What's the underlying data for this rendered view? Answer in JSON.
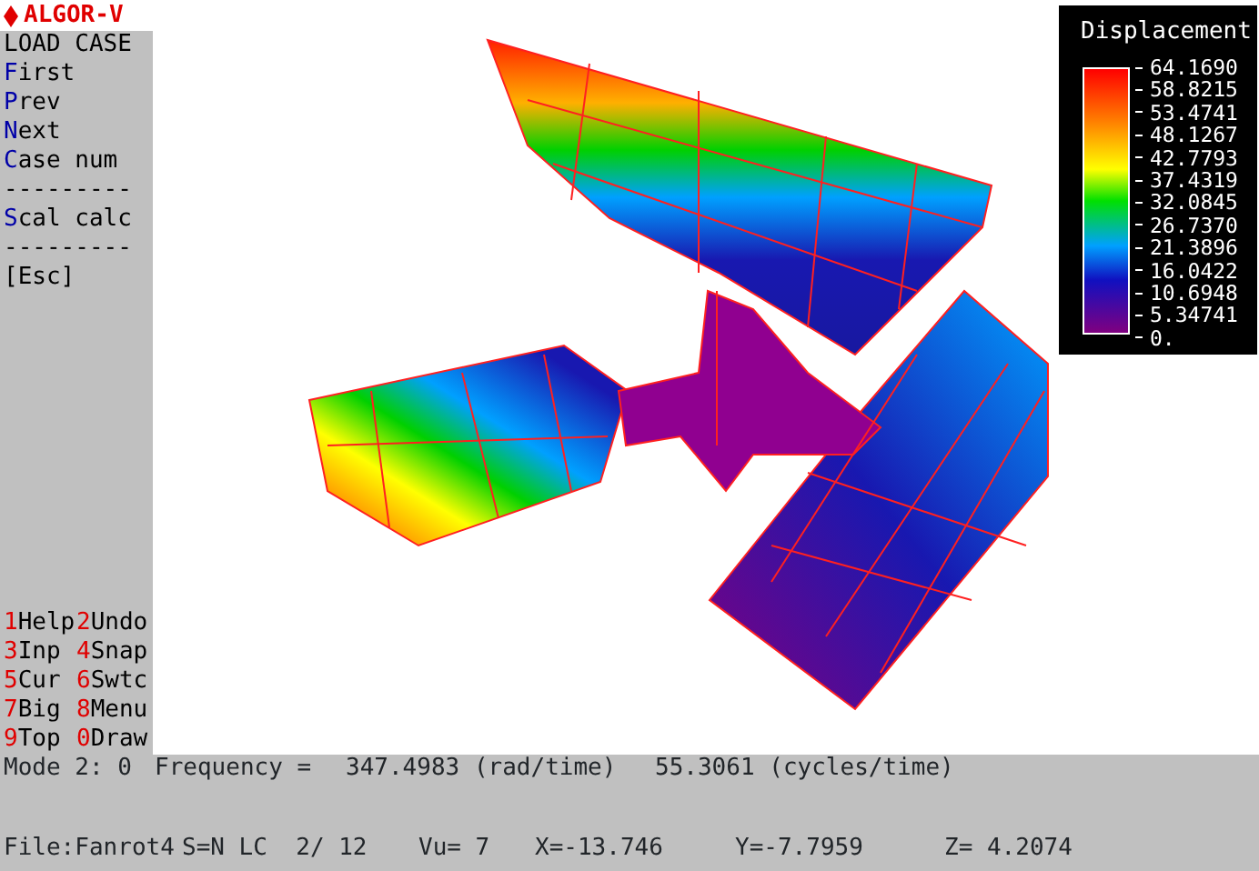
{
  "app_title": "ALGOR-V",
  "menu": {
    "heading": "LOAD CASE",
    "items": [
      {
        "kind": "command",
        "label": "First"
      },
      {
        "kind": "command",
        "label": "Prev"
      },
      {
        "kind": "command",
        "label": "Next"
      },
      {
        "kind": "command",
        "label": "Case num"
      },
      {
        "kind": "separator",
        "label": "---------"
      },
      {
        "kind": "command",
        "label": "Scal calc"
      },
      {
        "kind": "separator",
        "label": "---------"
      },
      {
        "kind": "plain",
        "label": "[Esc]"
      }
    ]
  },
  "function_keys": [
    [
      "1Help",
      "2Undo"
    ],
    [
      "3Inp",
      "4Snap"
    ],
    [
      "5Cur",
      "6Swtc"
    ],
    [
      "7Big",
      "8Menu"
    ],
    [
      "9Top",
      "0Draw"
    ]
  ],
  "legend": {
    "title": "Displacement",
    "labels": [
      "64.1690",
      "58.8215",
      "53.4741",
      "48.1267",
      "42.7793",
      "37.4319",
      "32.0845",
      "26.7370",
      "21.3896",
      "16.0422",
      "10.6948",
      "5.34741",
      "0."
    ]
  },
  "mode_line": [
    "Mode 2: 0",
    "Frequency =",
    "347.4983 (rad/time)",
    "55.3061 (cycles/time)"
  ],
  "status_bar": [
    "File:Fanrot4",
    "S=N LC  2/ 12",
    "Vu= 7",
    "X=-13.746",
    "Y=-7.7959",
    "Z= 4.2074"
  ]
}
